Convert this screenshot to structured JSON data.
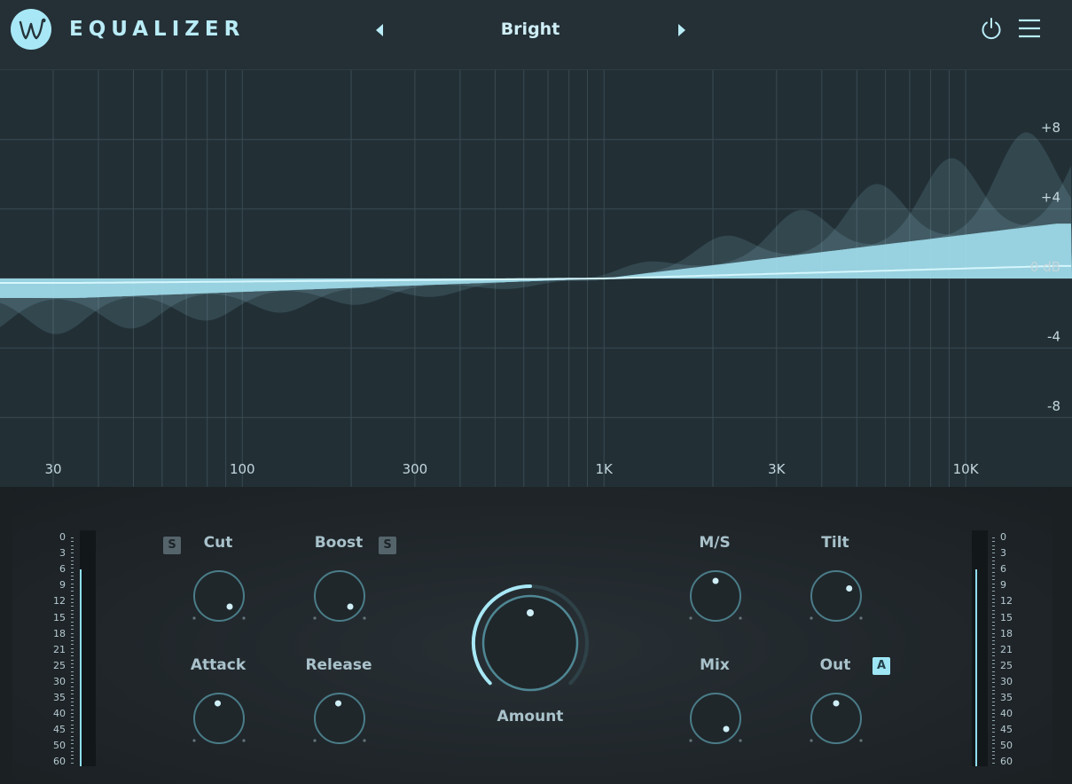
{
  "header": {
    "app_title": "EQUALIZER",
    "preset_name": "Bright",
    "logo_icon": "w-script-logo-icon",
    "prev_icon": "triangle-left-icon",
    "next_icon": "triangle-right-icon",
    "power_icon": "power-icon",
    "menu_icon": "hamburger-menu-icon"
  },
  "graph": {
    "db_labels": [
      "+8",
      "+4",
      "0 dB",
      "-4",
      "-8"
    ],
    "freq_labels": [
      "30",
      "100",
      "300",
      "1K",
      "3K",
      "10K"
    ],
    "curve_color": "#a8e8f6"
  },
  "meters": {
    "scale": [
      "0",
      "3",
      "6",
      "9",
      "12",
      "15",
      "18",
      "21",
      "25",
      "30",
      "35",
      "40",
      "45",
      "50",
      "60"
    ],
    "left_level_db": 6,
    "right_level_db": 6
  },
  "knobs": {
    "cut": {
      "label": "Cut",
      "solo": "S"
    },
    "boost": {
      "label": "Boost",
      "solo": "S"
    },
    "attack": {
      "label": "Attack"
    },
    "release": {
      "label": "Release"
    },
    "amount": {
      "label": "Amount"
    },
    "ms": {
      "label": "M/S"
    },
    "tilt": {
      "label": "Tilt"
    },
    "mix": {
      "label": "Mix"
    },
    "out": {
      "label": "Out",
      "auto": "A"
    }
  },
  "colors": {
    "accent": "#a8e8f6",
    "background": "#1b2125",
    "header": "#243036"
  }
}
